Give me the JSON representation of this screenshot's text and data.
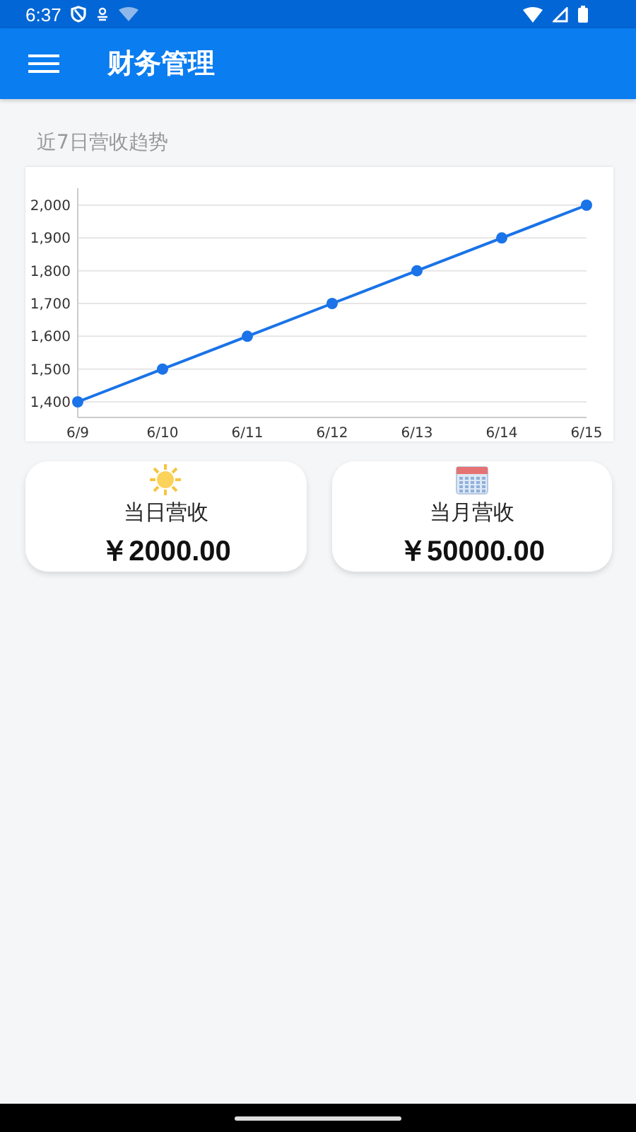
{
  "status_bar": {
    "time": "6:37"
  },
  "app_bar": {
    "title": "财务管理"
  },
  "trend": {
    "title": "近7日营收趋势",
    "chart_data": {
      "type": "line",
      "categories": [
        "6/9",
        "6/10",
        "6/11",
        "6/12",
        "6/13",
        "6/14",
        "6/15"
      ],
      "grid": true,
      "series": [
        {
          "color": "#1a73e8",
          "marker": "circle",
          "values": [
            1400,
            1500,
            1600,
            1700,
            1800,
            1900,
            2000
          ]
        }
      ],
      "ylim": [
        1400,
        2000
      ],
      "yticks": [
        {
          "value": 1400,
          "label": "1,400"
        },
        {
          "value": 1500,
          "label": "1,500"
        },
        {
          "value": 1600,
          "label": "1,600"
        },
        {
          "value": 1700,
          "label": "1,700"
        },
        {
          "value": 1800,
          "label": "1,800"
        },
        {
          "value": 1900,
          "label": "1,900"
        },
        {
          "value": 2000,
          "label": "2,000"
        }
      ]
    }
  },
  "cards": [
    {
      "kind": "day",
      "label": "当日营收",
      "value": "￥2000.00"
    },
    {
      "kind": "month",
      "label": "当月营收",
      "value": "￥50000.00"
    }
  ]
}
